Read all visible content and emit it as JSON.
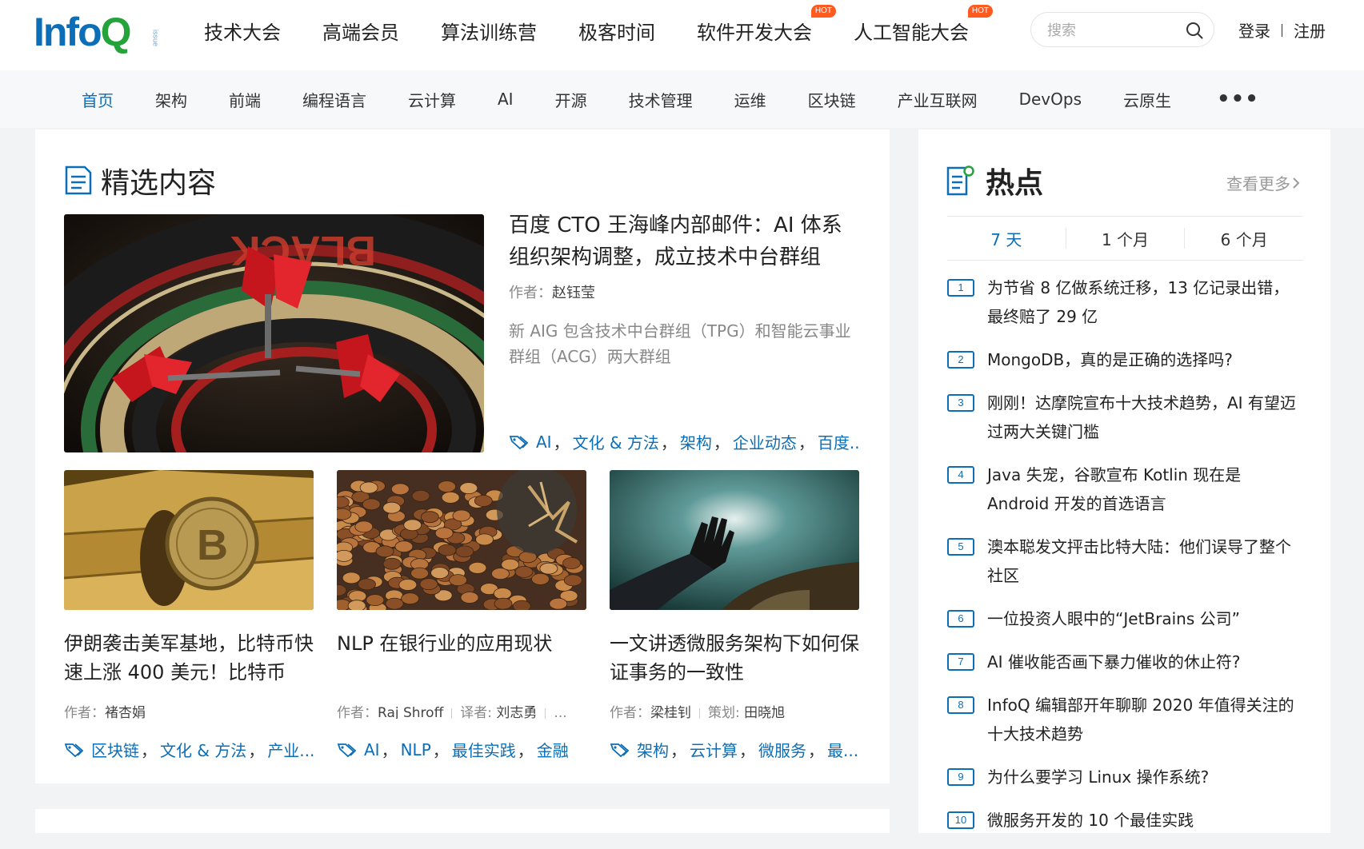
{
  "logo": {
    "text_main": "Info",
    "text_q": "Q",
    "tag": "issue"
  },
  "top_nav": [
    {
      "label": "技术大会",
      "hot": ""
    },
    {
      "label": "高端会员",
      "hot": ""
    },
    {
      "label": "算法训练营",
      "hot": ""
    },
    {
      "label": "极客时间",
      "hot": ""
    },
    {
      "label": "软件开发大会",
      "hot": "HOT"
    },
    {
      "label": "人工智能大会",
      "hot": "HOT"
    }
  ],
  "search": {
    "placeholder": "搜索",
    "value": ""
  },
  "auth": {
    "login": "登录",
    "register": "注册"
  },
  "categories": [
    "首页",
    "架构",
    "前端",
    "编程语言",
    "云计算",
    "AI",
    "开源",
    "技术管理",
    "运维",
    "区块链",
    "产业互联网",
    "DevOps",
    "云原生"
  ],
  "categories_active_index": 0,
  "categories_more": "•••",
  "featured": {
    "section_title": "精选内容",
    "hero": {
      "title": "百度 CTO 王海峰内部邮件：AI 体系组织架构调整，成立技术中台群组",
      "author_label": "作者：",
      "author": "赵钰莹",
      "desc": "新 AIG 包含技术中台群组（TPG）和智能云事业群组（ACG）两大群组",
      "tags": [
        "AI",
        "文化 & 方法",
        "架构",
        "企业动态",
        "百度..."
      ],
      "image": "darts-on-dartboard"
    },
    "cards": [
      {
        "title": "伊朗袭击美军基地，比特币快速上涨 400 美元！比特币成...",
        "author_label": "作者：",
        "author": "褚杏娟",
        "extra_label": "",
        "extra": "",
        "tags": [
          "区块链",
          "文化 & 方法",
          "产业..."
        ],
        "image": "bitcoin-on-gold-bars"
      },
      {
        "title": "NLP 在银行业的应用现状",
        "author_label": "作者：",
        "author": "Raj Shroff",
        "extra_label": "译者: ",
        "extra": "刘志勇",
        "tail": "...",
        "tags": [
          "AI",
          "NLP",
          "最佳实践",
          "金融"
        ],
        "image": "coins-from-jar"
      },
      {
        "title": "一文讲透微服务架构下如何保证事务的一致性",
        "author_label": "作者：",
        "author": "梁桂钊",
        "extra_label": "策划: ",
        "extra": "田晓旭",
        "tags": [
          "架构",
          "云计算",
          "微服务",
          "最..."
        ],
        "image": "hand-reaching-sky"
      }
    ]
  },
  "sidebar": {
    "title": "热点",
    "see_more": "查看更多",
    "tabs": [
      "7 天",
      "1 个月",
      "6 个月"
    ],
    "active_tab": 0,
    "items": [
      {
        "num": "1",
        "text": "为节省 8 亿做系统迁移，13 亿记录出错，最终赔了 29 亿"
      },
      {
        "num": "2",
        "text": "MongoDB，真的是正确的选择吗?"
      },
      {
        "num": "3",
        "text": "刚刚！达摩院宣布十大技术趋势，AI 有望迈过两大关键门槛"
      },
      {
        "num": "4",
        "text": "Java 失宠，谷歌宣布 Kotlin 现在是 Android 开发的首选语言"
      },
      {
        "num": "5",
        "text": "澳本聪发文抨击比特大陆：他们误导了整个社区"
      },
      {
        "num": "6",
        "text": "一位投资人眼中的“JetBrains 公司”"
      },
      {
        "num": "7",
        "text": "AI 催收能否画下暴力催收的休止符?"
      },
      {
        "num": "8",
        "text": "InfoQ 编辑部开年聊聊 2020 年值得关注的十大技术趋势"
      },
      {
        "num": "9",
        "text": "为什么要学习 Linux 操作系统?"
      },
      {
        "num": "10",
        "text": "微服务开发的 10 个最佳实践"
      }
    ]
  },
  "colors": {
    "accent": "#0c6eb6",
    "logo_q": "#23a33a",
    "hot_badge": "#ff5a1f"
  }
}
